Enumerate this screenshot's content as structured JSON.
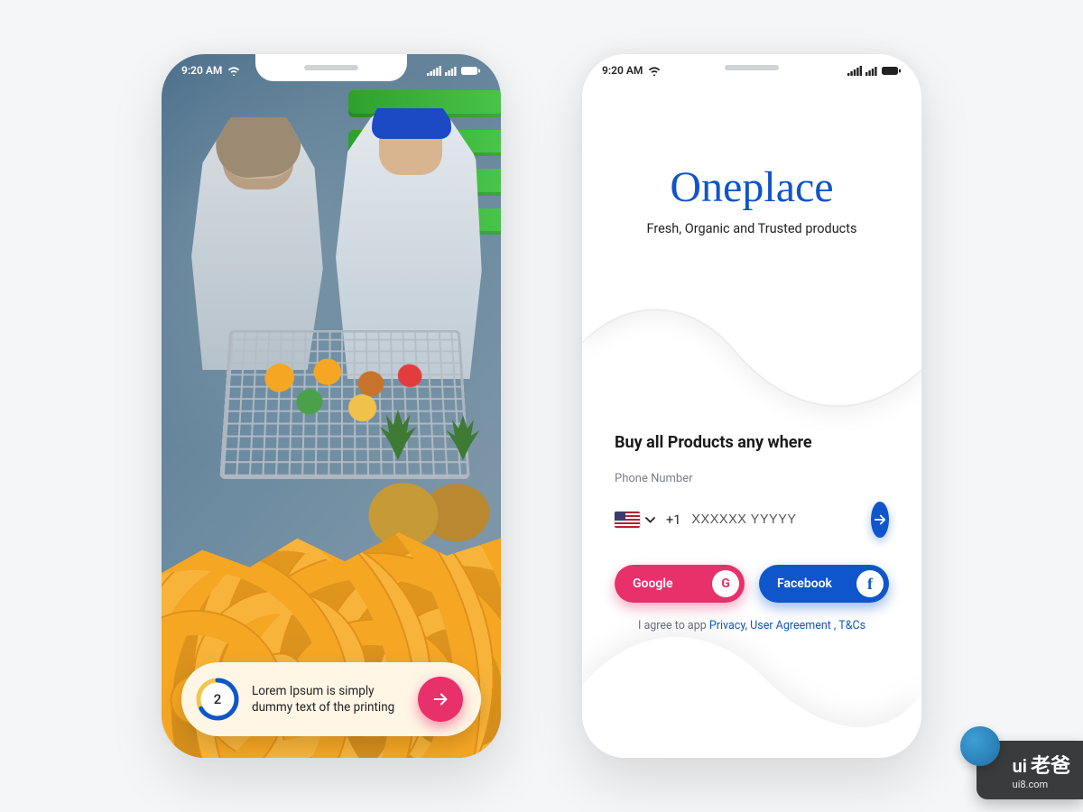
{
  "status": {
    "time": "9:20 AM"
  },
  "onboarding": {
    "step": "2",
    "text": "Lorem Ipsum is simply dummy text of the printing"
  },
  "login": {
    "brand": "Oneplace",
    "tagline": "Fresh, Organic and Trusted products",
    "heading": "Buy all Products any where",
    "phone_label": "Phone Number",
    "phone_prefix": "+1",
    "phone_placeholder": "XXXXXX YYYYY",
    "google_label": "Google",
    "facebook_label": "Facebook",
    "agree_prefix": "I agree to app ",
    "agree_links": "Privacy, User Agreement , T&Cs"
  },
  "watermark": {
    "brand_prefix": "ui",
    "brand_cn": "老爸",
    "url": "ui8.com"
  },
  "colors": {
    "accent_pink": "#e8306b",
    "accent_blue": "#0f56cc",
    "brand_blue": "#1154c9"
  }
}
